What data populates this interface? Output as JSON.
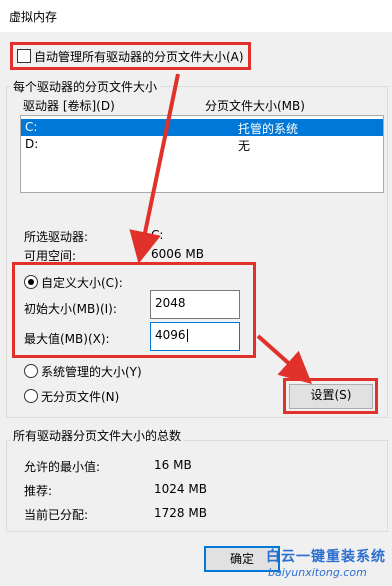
{
  "window": {
    "title": "虚拟内存"
  },
  "auto_manage": {
    "label": "自动管理所有驱动器的分页文件大小(A)",
    "checked": false
  },
  "per_drive_group": {
    "title": "每个驱动器的分页文件大小",
    "col_drive": "驱动器 [卷标](D)",
    "col_size": "分页文件大小(MB)",
    "rows": [
      {
        "drive": "C:",
        "size": "托管的系统",
        "selected": true
      },
      {
        "drive": "D:",
        "size": "无",
        "selected": false
      }
    ],
    "selected_drive_label": "所选驱动器:",
    "selected_drive_value": "C:",
    "free_space_label": "可用空间:",
    "free_space_value": "6006 MB",
    "custom_size": {
      "label": "自定义大小(C):",
      "selected": true
    },
    "initial_size": {
      "label": "初始大小(MB)(I):",
      "value": "2048"
    },
    "max_size": {
      "label": "最大值(MB)(X):",
      "value": "4096"
    },
    "system_managed": {
      "label": "系统管理的大小(Y)"
    },
    "no_paging": {
      "label": "无分页文件(N)"
    },
    "set_button": "设置(S)"
  },
  "total_group": {
    "title": "所有驱动器分页文件大小的总数",
    "min_label": "允许的最小值:",
    "min_value": "16 MB",
    "recommended_label": "推荐:",
    "recommended_value": "1024 MB",
    "allocated_label": "当前已分配:",
    "allocated_value": "1728 MB"
  },
  "ok_button": "确定",
  "watermark": {
    "line1": "白云一键重装系统",
    "line2": "baiyunxitong.com"
  },
  "colors": {
    "annotation_red": "#e0312b",
    "selection_blue": "#0078d7",
    "watermark_blue": "#2c6fd0"
  }
}
